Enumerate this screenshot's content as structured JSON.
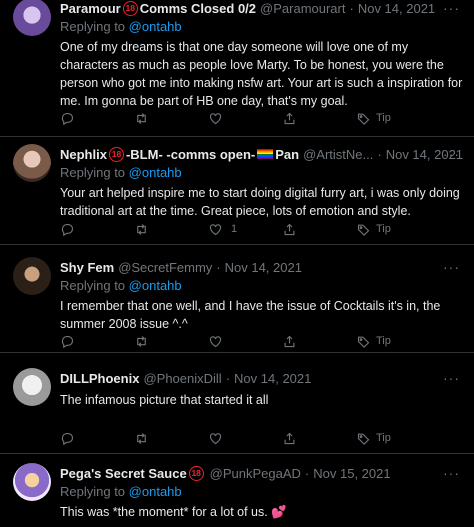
{
  "tweets": [
    {
      "name_a": "Paramour",
      "name_b": "Comms Closed 0/2",
      "badge": "18",
      "handle": "@Paramourart",
      "dot": "·",
      "date": "Nov 14, 2021",
      "more": "···",
      "replying_label": "Replying to",
      "mention": "@ontahb",
      "text": "One of my dreams is that one day someone will love one of my characters as much as people love Marty. To be honest, you were the person who got me into making nsfw art. Your art is such a inspiration for me. Im gonna be part of HB one day, that's my goal.",
      "like_count": "",
      "tip_label": "Tip"
    },
    {
      "name_a": "Nephlix",
      "name_b": "-BLM- -comms open-",
      "name_c": "Pan",
      "badge": "18",
      "handle": "@ArtistNe...",
      "dot": "·",
      "date": "Nov 14, 2021",
      "more": "···",
      "replying_label": "Replying to",
      "mention": "@ontahb",
      "text": "Your art helped inspire me to start doing digital furry art, i was only doing traditional art at the time. Great piece, lots of emotion and style.",
      "like_count": "1",
      "tip_label": "Tip"
    },
    {
      "name": "Shy Fem",
      "handle": "@SecretFemmy",
      "dot": "·",
      "date": "Nov 14, 2021",
      "more": "···",
      "replying_label": "Replying to",
      "mention": "@ontahb",
      "text": "I remember that one well, and I have the issue of Cocktails it's in, the summer 2008 issue ^.^",
      "like_count": "",
      "tip_label": "Tip"
    },
    {
      "name": "DILLPhoenix",
      "handle": "@PhoenixDill",
      "dot": "·",
      "date": "Nov 14, 2021",
      "more": "···",
      "text": "The infamous picture that started it all",
      "like_count": "",
      "tip_label": "Tip"
    },
    {
      "name": "Pega's Secret Sauce",
      "badge": "18",
      "handle": "@PunkPegaAD",
      "dot": "·",
      "date": "Nov 15, 2021",
      "more": "···",
      "replying_label": "Replying to",
      "mention": "@ontahb",
      "text": "This was *the moment* for a lot of us.",
      "emoji": "💕"
    }
  ],
  "colors": {
    "background": "#000000",
    "text": "#e7e9ea",
    "muted": "#71767b",
    "link": "#1d9bf0",
    "divider": "#2f3336",
    "badge": "#f4212e"
  }
}
